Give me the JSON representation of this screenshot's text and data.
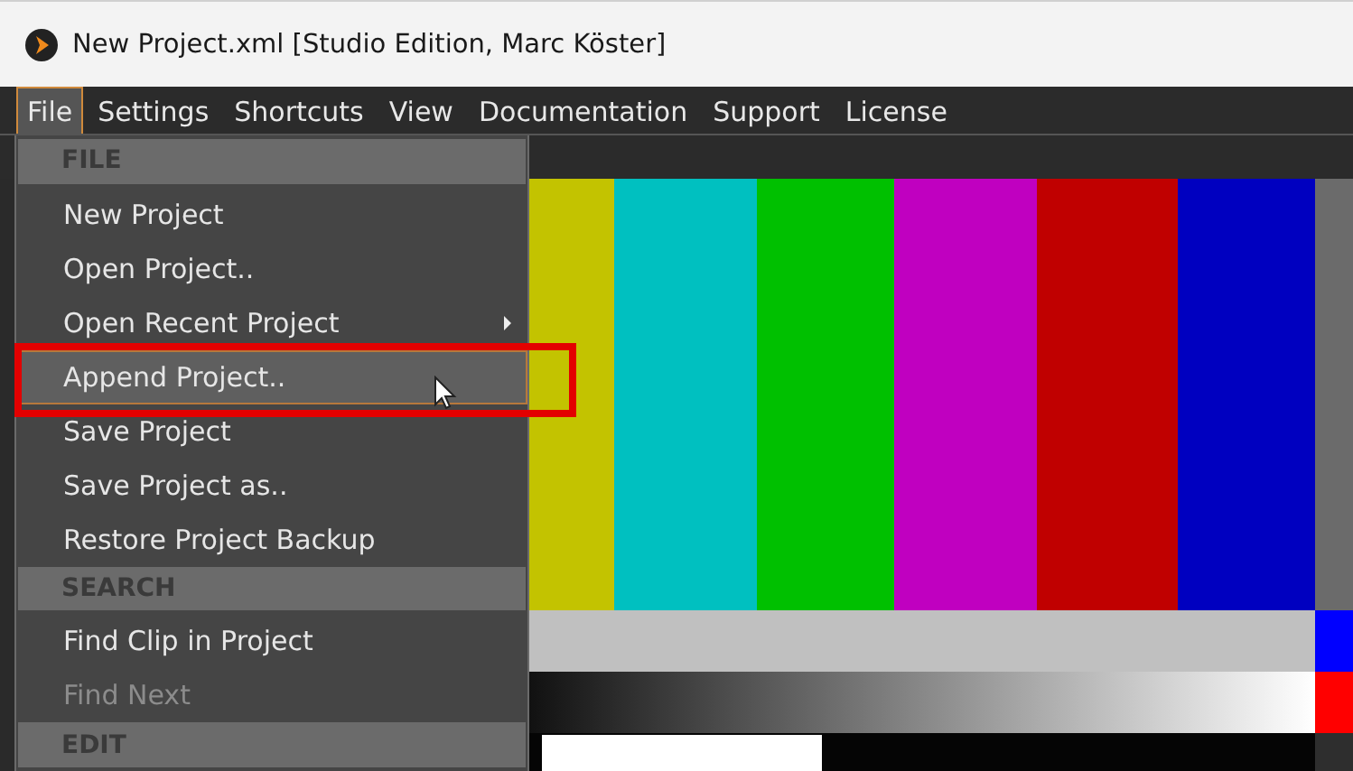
{
  "window": {
    "title": "New Project.xml [Studio Edition, Marc Köster]"
  },
  "menu_bar": [
    {
      "label": "File",
      "selected": true
    },
    {
      "label": "Settings",
      "selected": false
    },
    {
      "label": "Shortcuts",
      "selected": false
    },
    {
      "label": "View",
      "selected": false
    },
    {
      "label": "Documentation",
      "selected": false
    },
    {
      "label": "Support",
      "selected": false
    },
    {
      "label": "License",
      "selected": false
    }
  ],
  "file_menu": [
    {
      "kind": "header",
      "label": "FILE"
    },
    {
      "kind": "item",
      "label": "New Project",
      "selected": false,
      "disabled": false,
      "submenu": false
    },
    {
      "kind": "item",
      "label": "Open Project..",
      "selected": false,
      "disabled": false,
      "submenu": false
    },
    {
      "kind": "item",
      "label": "Open Recent Project",
      "selected": false,
      "disabled": false,
      "submenu": true
    },
    {
      "kind": "item",
      "label": "Append Project..",
      "selected": true,
      "disabled": false,
      "submenu": false
    },
    {
      "kind": "item",
      "label": "Save Project",
      "selected": false,
      "disabled": false,
      "submenu": false
    },
    {
      "kind": "item",
      "label": "Save Project as..",
      "selected": false,
      "disabled": false,
      "submenu": false
    },
    {
      "kind": "item",
      "label": "Restore Project Backup",
      "selected": false,
      "disabled": false,
      "submenu": false
    },
    {
      "kind": "header",
      "label": "SEARCH"
    },
    {
      "kind": "item",
      "label": "Find Clip in Project",
      "selected": false,
      "disabled": false,
      "submenu": false
    },
    {
      "kind": "item",
      "label": "Find Next",
      "selected": false,
      "disabled": true,
      "submenu": false
    },
    {
      "kind": "header",
      "label": "EDIT"
    }
  ]
}
